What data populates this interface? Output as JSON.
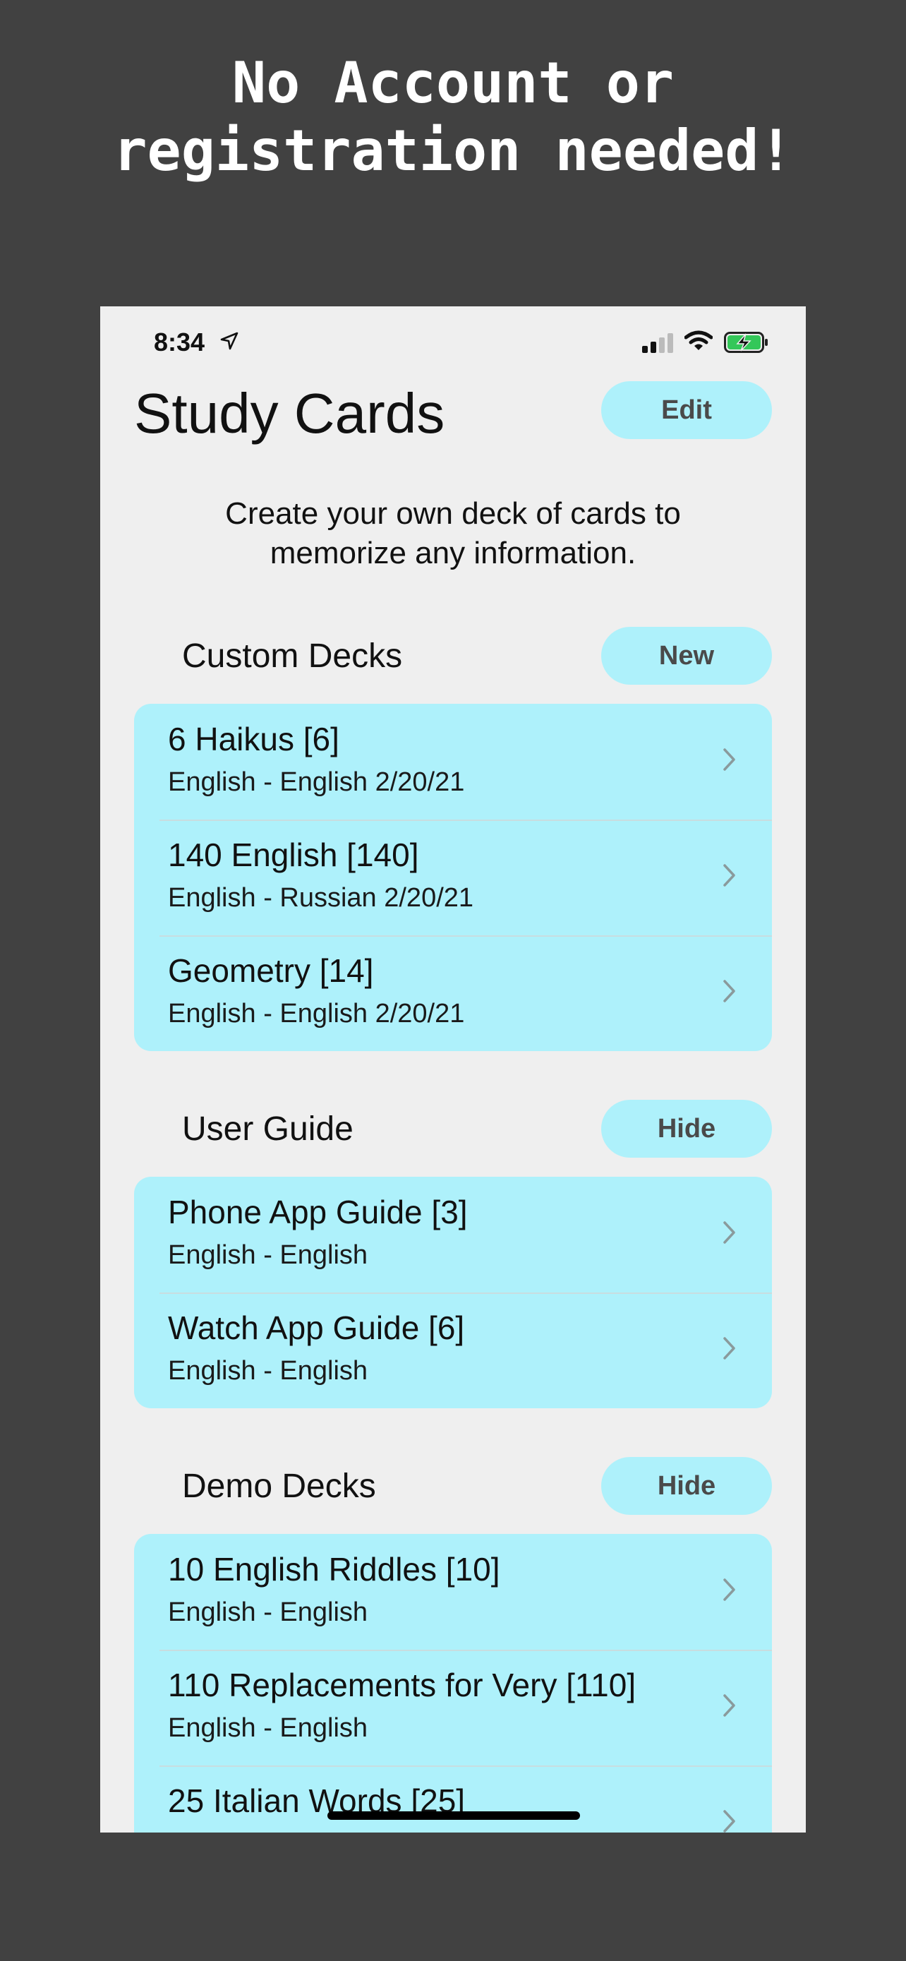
{
  "promo": {
    "headline": "No Account or\nregistration needed!"
  },
  "status_bar": {
    "time": "8:34"
  },
  "app": {
    "title": "Study Cards",
    "edit_label": "Edit",
    "subtitle": "Create your own deck of cards to\nmemorize any information."
  },
  "sections": {
    "custom": {
      "title": "Custom Decks",
      "button": "New",
      "decks": [
        {
          "name": "6 Haikus [6]",
          "detail": "English - English 2/20/21"
        },
        {
          "name": "140 English [140]",
          "detail": "English - Russian 2/20/21"
        },
        {
          "name": "Geometry [14]",
          "detail": "English - English 2/20/21"
        }
      ]
    },
    "guide": {
      "title": "User Guide",
      "button": "Hide",
      "decks": [
        {
          "name": "Phone App Guide [3]",
          "detail": "English - English"
        },
        {
          "name": "Watch App Guide [6]",
          "detail": "English - English"
        }
      ]
    },
    "demo": {
      "title": "Demo Decks",
      "button": "Hide",
      "decks": [
        {
          "name": "10 English Riddles [10]",
          "detail": "English - English"
        },
        {
          "name": "110 Replacements for Very [110]",
          "detail": "English - English"
        },
        {
          "name": "25 Italian Words [25]",
          "detail": ""
        }
      ]
    }
  },
  "colors": {
    "background": "#414141",
    "screen": "#efefef",
    "accent": "#aef1fb",
    "button_text": "#4a4a4a",
    "battery": "#34c759"
  },
  "icons": [
    "location-arrow-icon",
    "signal-icon",
    "wifi-icon",
    "battery-charging-icon",
    "chevron-right-icon"
  ]
}
